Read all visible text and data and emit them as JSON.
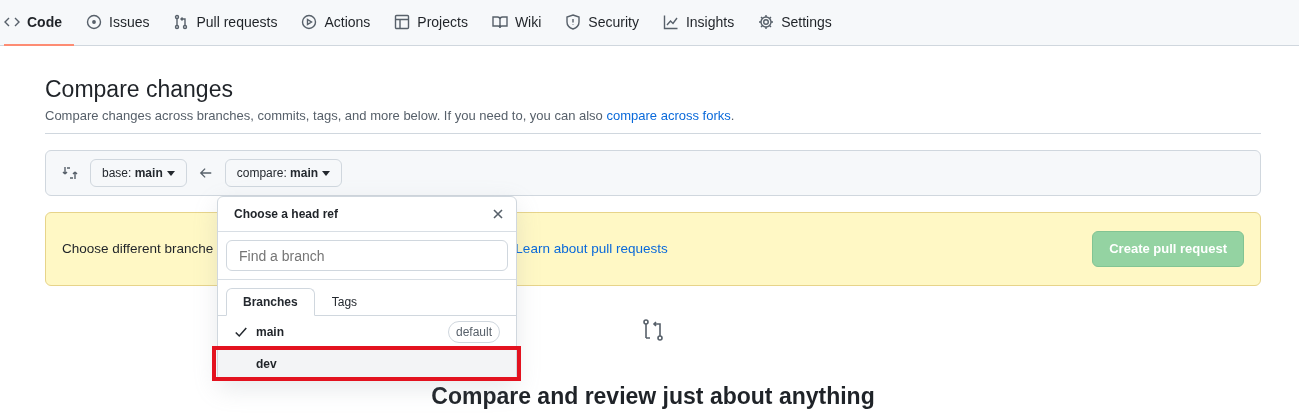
{
  "repo_tabs": [
    {
      "label": "Code",
      "selected": true
    },
    {
      "label": "Issues",
      "selected": false
    },
    {
      "label": "Pull requests",
      "selected": false
    },
    {
      "label": "Actions",
      "selected": false
    },
    {
      "label": "Projects",
      "selected": false
    },
    {
      "label": "Wiki",
      "selected": false
    },
    {
      "label": "Security",
      "selected": false
    },
    {
      "label": "Insights",
      "selected": false
    },
    {
      "label": "Settings",
      "selected": false
    }
  ],
  "title": "Compare changes",
  "subtitle": {
    "text": "Compare changes across branches, commits, tags, and more below. If you need to, you can also ",
    "link": "compare across forks",
    "end": "."
  },
  "range": {
    "base_label": "base:",
    "base": "main",
    "compare_label": "compare:",
    "compare": "main"
  },
  "flash": {
    "text": "Choose different branche",
    "link": "Learn about pull requests",
    "button": "Create pull request",
    "button_disabled": true
  },
  "dropdown": {
    "title": "Choose a head ref",
    "search": {
      "placeholder": "Find a branch"
    },
    "tabs": [
      {
        "label": "Branches",
        "selected": true
      },
      {
        "label": "Tags",
        "selected": false
      }
    ],
    "items": [
      {
        "name": "main",
        "checked": true,
        "badge": "default",
        "highlighted": false
      },
      {
        "name": "dev",
        "checked": false,
        "highlighted": true
      }
    ]
  },
  "blankslate": {
    "heading": "Compare and review just about anything"
  }
}
